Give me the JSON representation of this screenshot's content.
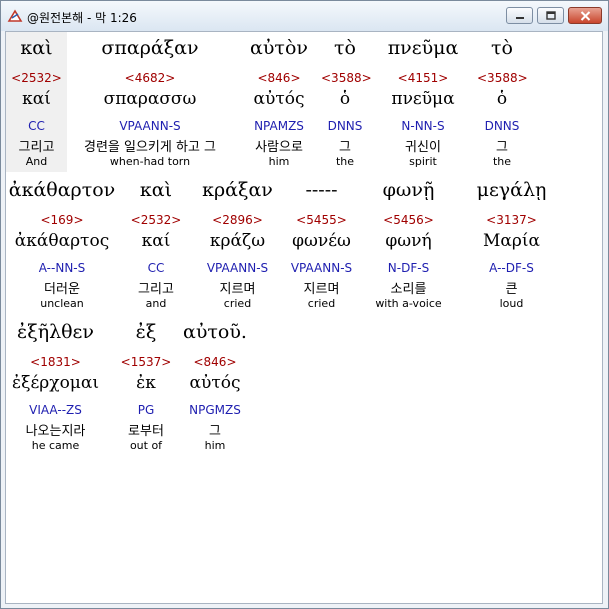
{
  "window": {
    "title": "@원전본해 - 막 1:26"
  },
  "lines": [
    [
      {
        "gk": "καὶ",
        "num": "<2532>",
        "lem": "καί",
        "par": "CC",
        "ko": "그리고",
        "en": "And"
      },
      {
        "gk": "σπαράξαν",
        "num": "<4682>",
        "lem": "σπαρασσω",
        "par": "VPAANN-S",
        "ko": "경련을 일으키게 하고 그",
        "en": "when-had torn"
      },
      {
        "gk": "αὐτὸν",
        "num": "<846>",
        "lem": "αὐτός",
        "par": "NPAMZS",
        "ko": "사람으로",
        "en": "him"
      },
      {
        "gk": "τὸ",
        "num": "<3588>",
        "lem": "ὁ",
        "par": "DNNS",
        "ko": "그",
        "en": "the"
      },
      {
        "gk": "πνεῦμα",
        "num": "<4151>",
        "lem": "πνεῦμα",
        "par": "N-NN-S",
        "ko": "귀신이",
        "en": "spirit"
      },
      {
        "gk": "τὸ",
        "num": "<3588>",
        "lem": "ὁ",
        "par": "DNNS",
        "ko": "그",
        "en": "the"
      }
    ],
    [
      {
        "gk": "ἀκάθαρτον",
        "num": "<169>",
        "lem": "ἀκάθαρτος",
        "par": "A--NN-S",
        "ko": "더러운",
        "en": "unclean"
      },
      {
        "gk": "καὶ",
        "num": "<2532>",
        "lem": "καί",
        "par": "CC",
        "ko": "그리고",
        "en": "and"
      },
      {
        "gk": "κράξαν",
        "num": "<2896>",
        "lem": "κράζω",
        "par": "VPAANN-S",
        "ko": "지르며",
        "en": "cried"
      },
      {
        "gk": "-----",
        "num": "<5455>",
        "lem": "φωνέω",
        "par": "VPAANN-S",
        "ko": "지르며",
        "en": "cried"
      },
      {
        "gk": "φωνῇ",
        "num": "<5456>",
        "lem": "φωνή",
        "par": "N-DF-S",
        "ko": "소리를",
        "en": "with a-voice"
      },
      {
        "gk": "μεγάλῃ",
        "num": "<3137>",
        "lem": "Μαρία",
        "par": "A--DF-S",
        "ko": "큰",
        "en": "loud"
      }
    ],
    [
      {
        "gk": "ἐξῆλθεν",
        "num": "<1831>",
        "lem": "ἐξέρχομαι",
        "par": "VIAA--ZS",
        "ko": "나오는지라",
        "en": "he came"
      },
      {
        "gk": "ἐξ",
        "num": "<1537>",
        "lem": "ἐκ",
        "par": "PG",
        "ko": "로부터",
        "en": "out of"
      },
      {
        "gk": "αὐτοῦ.",
        "num": "<846>",
        "lem": "αὐτός",
        "par": "NPGMZS",
        "ko": "그",
        "en": "him"
      }
    ]
  ]
}
